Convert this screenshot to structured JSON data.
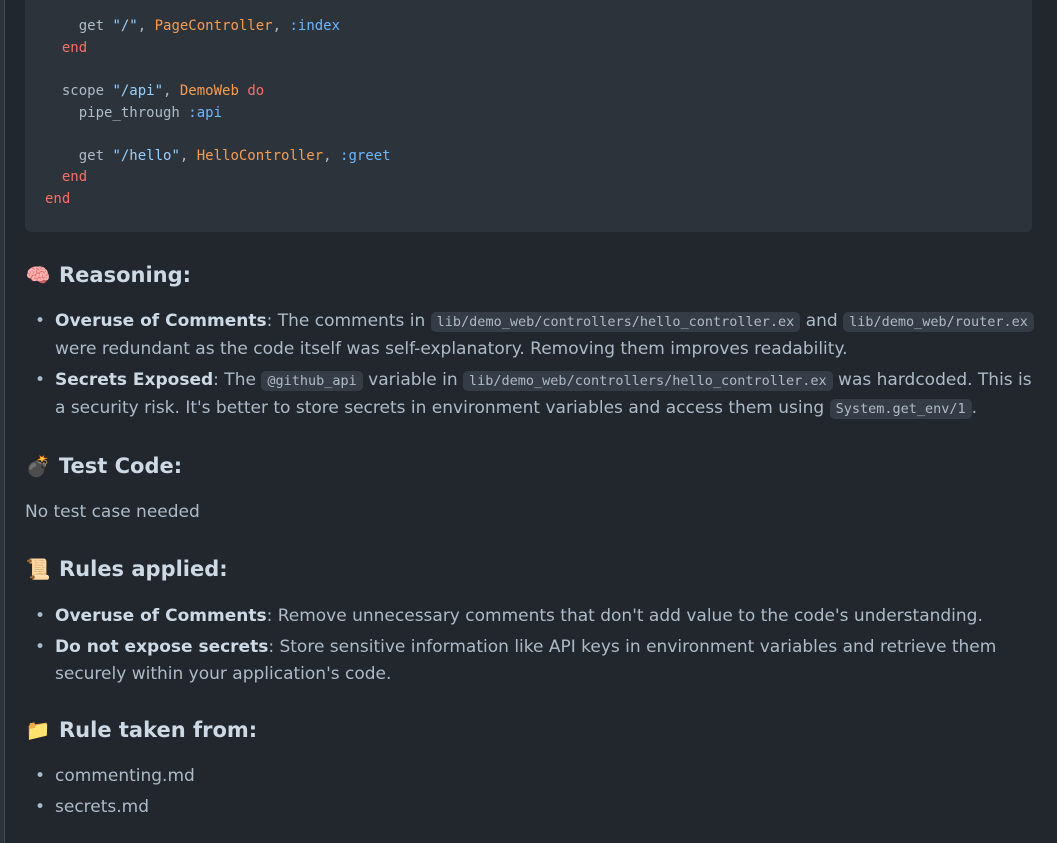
{
  "code": {
    "lines": [
      {
        "parts": [
          [
            "plain",
            "    get "
          ],
          [
            "str",
            "\"/\""
          ],
          [
            "plain",
            ", "
          ],
          [
            "mod",
            "PageController"
          ],
          [
            "plain",
            ", "
          ],
          [
            "atom",
            ":index"
          ]
        ]
      },
      {
        "parts": [
          [
            "kw",
            "  end"
          ]
        ]
      },
      {
        "parts": [
          [
            "plain",
            ""
          ]
        ]
      },
      {
        "parts": [
          [
            "plain",
            "  scope "
          ],
          [
            "str",
            "\"/api\""
          ],
          [
            "plain",
            ", "
          ],
          [
            "mod",
            "DemoWeb"
          ],
          [
            "kw",
            " do"
          ]
        ]
      },
      {
        "parts": [
          [
            "plain",
            "    pipe_through "
          ],
          [
            "atom",
            ":api"
          ]
        ]
      },
      {
        "parts": [
          [
            "plain",
            ""
          ]
        ]
      },
      {
        "parts": [
          [
            "plain",
            "    get "
          ],
          [
            "str",
            "\"/hello\""
          ],
          [
            "plain",
            ", "
          ],
          [
            "mod",
            "HelloController"
          ],
          [
            "plain",
            ", "
          ],
          [
            "atom",
            ":greet"
          ]
        ]
      },
      {
        "parts": [
          [
            "kw",
            "  end"
          ]
        ]
      },
      {
        "parts": [
          [
            "kw",
            "end"
          ]
        ]
      }
    ]
  },
  "reasoning": {
    "emoji": "🧠",
    "title": "Reasoning:",
    "items": [
      {
        "label": "Overuse of Comments",
        "t1": ": The comments in ",
        "c1": "lib/demo_web/controllers/hello_controller.ex",
        "t2": " and ",
        "c2": "lib/demo_web/router.ex",
        "t3": " were redundant as the code itself was self-explanatory. Removing them improves readability."
      },
      {
        "label": "Secrets Exposed",
        "t1": ": The ",
        "c1": "@github_api",
        "t2": " variable in ",
        "c2": "lib/demo_web/controllers/hello_controller.ex",
        "t3": " was hardcoded. This is a security risk. It's better to store secrets in environment variables and access them using ",
        "c3": "System.get_env/1",
        "t4": "."
      }
    ]
  },
  "test_code": {
    "emoji": "💣",
    "title": "Test Code:",
    "text": "No test case needed"
  },
  "rules_applied": {
    "emoji": "📜",
    "title": "Rules applied:",
    "items": [
      {
        "label": "Overuse of Comments",
        "text": ": Remove unnecessary comments that don't add value to the code's understanding."
      },
      {
        "label": "Do not expose secrets",
        "text": ": Store sensitive information like API keys in environment variables and retrieve them securely within your application's code."
      }
    ]
  },
  "rule_source": {
    "emoji": "📁",
    "title": "Rule taken from:",
    "items": [
      "commenting.md",
      "secrets.md"
    ]
  }
}
